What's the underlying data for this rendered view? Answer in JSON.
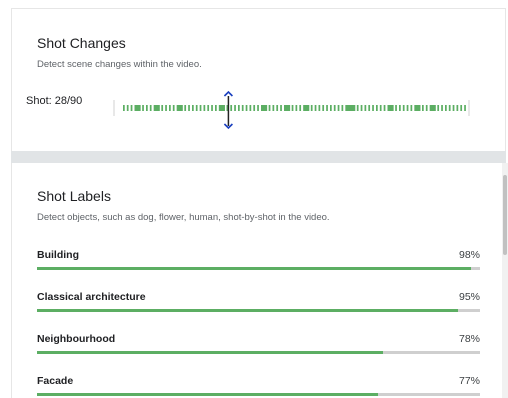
{
  "shot_changes": {
    "title": "Shot Changes",
    "description": "Detect scene changes within the video.",
    "shot_label": "Shot: 28/90",
    "current_shot": 28,
    "total_shots": 90,
    "accent_color": "#5cae63",
    "cursor_color": "#1a3fbf"
  },
  "shot_labels": {
    "title": "Shot Labels",
    "description": "Detect objects, such as dog, flower, human, shot-by-shot in the video.",
    "items": [
      {
        "name": "Building",
        "percent_text": "98%",
        "value": 0.98
      },
      {
        "name": "Classical architecture",
        "percent_text": "95%",
        "value": 0.95
      },
      {
        "name": "Neighbourhood",
        "percent_text": "78%",
        "value": 0.78
      },
      {
        "name": "Facade",
        "percent_text": "77%",
        "value": 0.77
      }
    ],
    "bar_color": "#5cae63",
    "track_color": "#cfcfcf"
  }
}
